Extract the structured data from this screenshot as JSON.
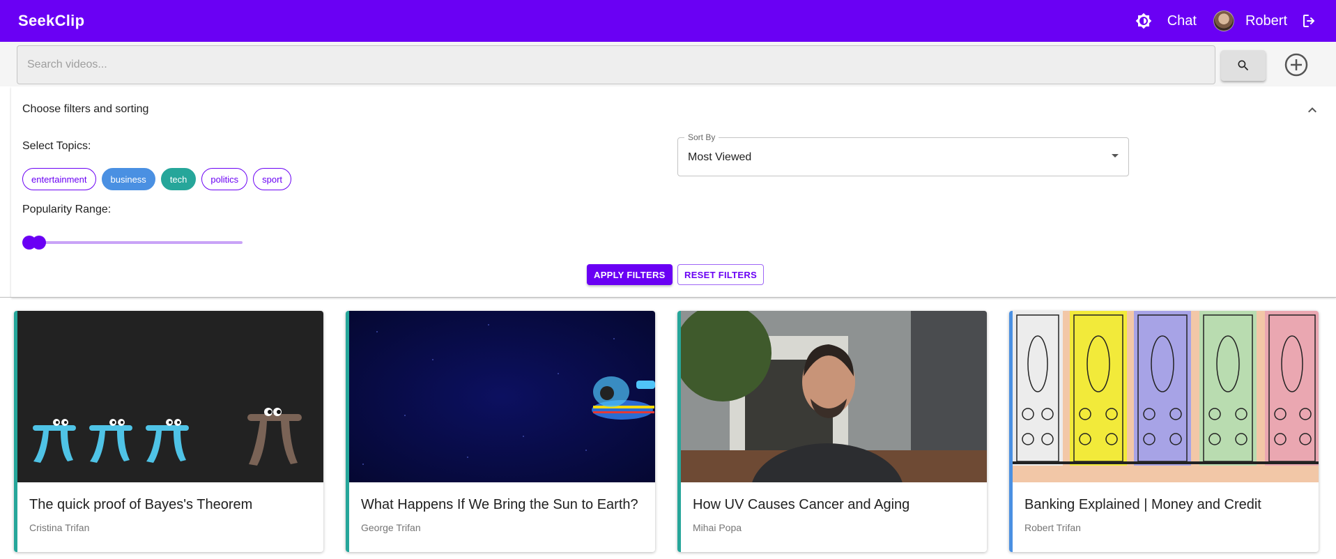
{
  "header": {
    "brand": "SeekClip",
    "chat_label": "Chat",
    "user_name": "Robert",
    "accent_color": "#6a00f4"
  },
  "search": {
    "placeholder": "Search videos...",
    "value": ""
  },
  "filters": {
    "title": "Choose filters and sorting",
    "topics_label": "Select Topics:",
    "topics": [
      {
        "label": "entertainment",
        "selected": false
      },
      {
        "label": "business",
        "selected": true,
        "color": "#4a90e2"
      },
      {
        "label": "tech",
        "selected": true,
        "color": "#26a69a"
      },
      {
        "label": "politics",
        "selected": false
      },
      {
        "label": "sport",
        "selected": false
      }
    ],
    "popularity_label": "Popularity Range:",
    "popularity_range": [
      0,
      0.02
    ],
    "sort_label": "Sort By",
    "sort_value": "Most Viewed",
    "apply_label": "APPLY FILTERS",
    "reset_label": "RESET FILTERS"
  },
  "videos": [
    {
      "title": "The quick proof of Bayes's Theorem",
      "author": "Cristina Trifan",
      "stripe_color": "#26a69a"
    },
    {
      "title": "What Happens If We Bring the Sun to Earth?",
      "author": "George Trifan",
      "stripe_color": "#26a69a"
    },
    {
      "title": "How UV Causes Cancer and Aging",
      "author": "Mihai Popa",
      "stripe_color": "#26a69a"
    },
    {
      "title": "Banking Explained | Money and Credit",
      "author": "Robert Trifan",
      "stripe_color": "#4a90e2"
    }
  ],
  "icons": [
    "theme-toggle-icon",
    "logout-icon",
    "search-icon",
    "add-circle-icon",
    "chevron-up-icon"
  ]
}
